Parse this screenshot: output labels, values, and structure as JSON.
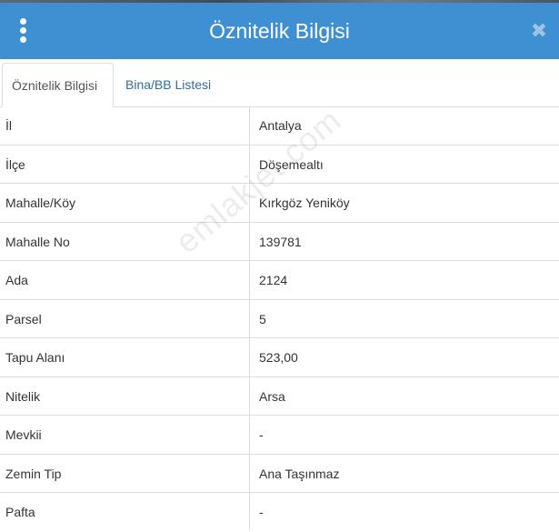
{
  "header": {
    "title": "Öznitelik Bilgisi",
    "menu_icon": "vertical-ellipsis-icon",
    "close_icon": "close-icon",
    "close_glyph": "✖",
    "bg_color": "#3f8fd3"
  },
  "tabs": [
    {
      "label": "Öznitelik Bilgisi",
      "active": true
    },
    {
      "label": "Bina/BB Listesi",
      "active": false
    }
  ],
  "rows": [
    {
      "label": "İl",
      "value": "Antalya"
    },
    {
      "label": "İlçe",
      "value": "Döşemealtı"
    },
    {
      "label": "Mahalle/Köy",
      "value": "Kırkgöz Yeniköy"
    },
    {
      "label": "Mahalle No",
      "value": "139781"
    },
    {
      "label": "Ada",
      "value": "2124"
    },
    {
      "label": "Parsel",
      "value": "5"
    },
    {
      "label": "Tapu Alanı",
      "value": "523,00"
    },
    {
      "label": "Nitelik",
      "value": "Arsa"
    },
    {
      "label": "Mevkii",
      "value": "-"
    },
    {
      "label": "Zemin Tip",
      "value": "Ana Taşınmaz"
    },
    {
      "label": "Pafta",
      "value": "-"
    }
  ],
  "watermark": "emlakjet.com"
}
